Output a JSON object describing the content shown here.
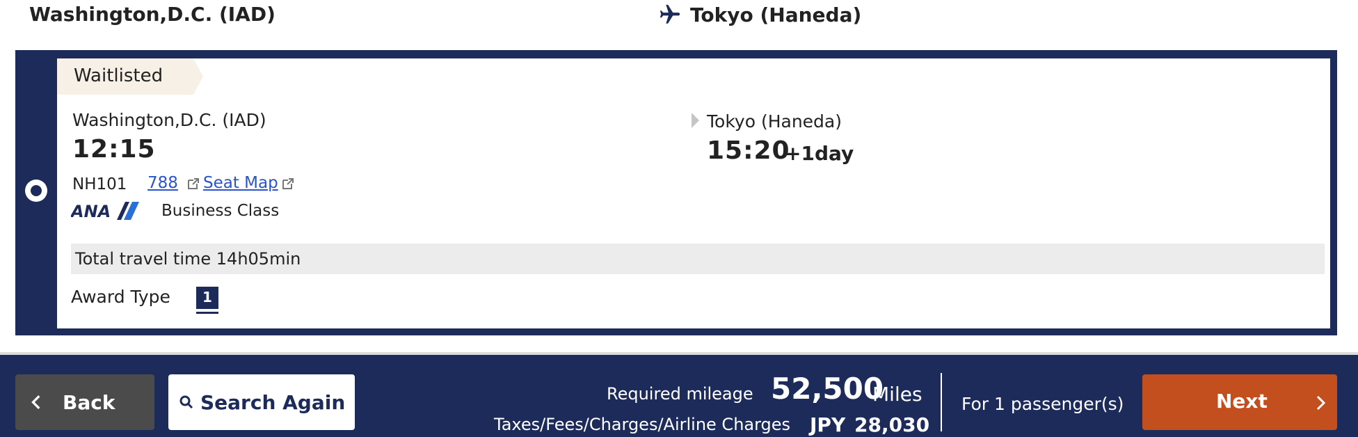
{
  "route": {
    "origin": "Washington,D.C. (IAD)",
    "destination": "Tokyo (Haneda)"
  },
  "flight": {
    "status": "Waitlisted",
    "departure_city": "Washington,D.C. (IAD)",
    "departure_time": "12:15",
    "arrival_city": "Tokyo (Haneda)",
    "arrival_time": "15:20",
    "arrival_day_offset": "+1day",
    "flight_number": "NH101",
    "aircraft_link": "788",
    "seat_map_link": "Seat Map",
    "airline_logo_text": "ANA",
    "cabin_class": "Business Class",
    "total_travel_time": "Total travel time 14h05min",
    "award_type_label": "Award Type",
    "award_type_value": "1"
  },
  "footer": {
    "back_label": "Back",
    "search_again_label": "Search Again",
    "mileage_label": "Required mileage",
    "mileage_value": "52,500",
    "mileage_unit": "Miles",
    "taxes_label": "Taxes/Fees/Charges/Airline Charges",
    "taxes_currency": "JPY",
    "taxes_value": "28,030",
    "passengers": "For 1 passenger(s)",
    "next_label": "Next"
  },
  "colors": {
    "navy": "#1c2b5a",
    "next_orange": "#c34f1f",
    "link_blue": "#2a54c9",
    "waitlist_tag": "#f7f0e6"
  },
  "icons": [
    "plane-icon",
    "external-link-icon",
    "chevron-left-icon",
    "search-icon",
    "chevron-right-icon",
    "arrow-right-icon"
  ]
}
